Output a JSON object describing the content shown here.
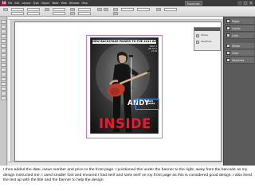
{
  "app": {
    "logo": "Id",
    "menu": [
      "File",
      "Edit",
      "Layout",
      "Type",
      "Object",
      "Table",
      "View",
      "Window",
      "Help"
    ],
    "workspace": "Essentials",
    "window_controls": [
      "–",
      "□",
      "×"
    ]
  },
  "cover": {
    "banner": "NEW BACKSTAGE PASSES TO THE 2013 AWARDS!",
    "info": [
      "ISSUE 4",
      "JAN 2013",
      "£3.99"
    ],
    "name": "ANDY",
    "name_sub": [
      "TALKS",
      "CAREER"
    ],
    "title": "INSIDE",
    "colors": {
      "title": "#e0203a",
      "guitar": "#c0392b"
    }
  },
  "panels": {
    "floating": [
      "Stroke",
      "Swatches"
    ],
    "dock": [
      "Pages",
      "Layers",
      "Links",
      "Stroke",
      "Color",
      "Swatches"
    ]
  },
  "icons": {
    "tools": [
      "selection-tool-icon",
      "direct-selection-tool-icon",
      "page-tool-icon",
      "gap-tool-icon",
      "type-tool-icon",
      "line-tool-icon",
      "pen-tool-icon",
      "pencil-tool-icon",
      "rectangle-frame-tool-icon",
      "rectangle-tool-icon",
      "scissors-tool-icon",
      "free-transform-tool-icon",
      "gradient-tool-icon",
      "note-tool-icon",
      "eyedropper-tool-icon",
      "hand-tool-icon",
      "zoom-tool-icon"
    ]
  },
  "caption": "I then added the date, issue number and price to the front page. I positioned this under the banner to the right, away from the barcode as my design instructed me. I used smaller font and ensured I had serif and sans serif on my front page as this is considered good design. I also lined the text up with the title and the banner to help the design."
}
